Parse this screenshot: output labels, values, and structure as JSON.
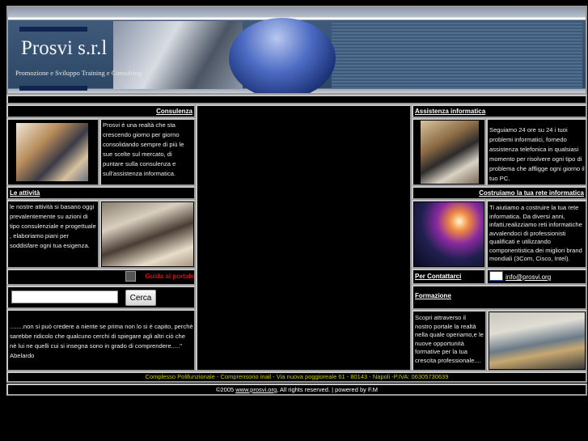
{
  "header": {
    "title": "Prosvi s.r.l",
    "subtitle": "Promozione e Sviluppo Training e Consulting"
  },
  "left": {
    "consulenza": {
      "label": "Consulenza",
      "text": "Prosvi è una realtà che sta crescendo giorno per giorno consolidando sempre di più le sue scelte sul mercato, di puntare sulla consulenza e sull'assistenza informatica."
    },
    "attivita": {
      "label": "Le attività",
      "text": "le nostre attività si basano oggi prevalentemente su azioni di tipo consulenziale e progettuale , elaboriamo piani per soddisfare ogni tua esigenza."
    },
    "guide": {
      "label": "Guida al portale"
    },
    "search": {
      "value": "",
      "button": "Cerca"
    },
    "quote": {
      "text": "........non si può credere a niente se prima non lo si è capito, perchè sarebbe ridicolo che qualcuno cerchi di spiegare agli altri ciò che nè lui ne quelli cui si insegna sono in grado di comprendere.....\"",
      "author": "Abelardo"
    }
  },
  "right": {
    "assistenza": {
      "label": "Assistenza informatica",
      "text": "Seguiamo 24 ore su 24 i tuoi problemi informatici, fornedo assistenza telefonica in qualsiasi momento per risolvere ogni tipo di problema che affligge ogni giorno il tuo PC."
    },
    "rete": {
      "label": "Costruiamo la tua rete informatica",
      "text": "Ti aiutiamo a costruire la tua rete informatica. Da diversi anni, infatti,realizziamo reti informatiche avvalendoci di professionisti qualificati e utilizzando componentistica dei migliori brand mondiali (3Com, Cisco, Intel)."
    },
    "contatti": {
      "label": "Per Contattarci",
      "email": "info@prosvi.org"
    },
    "formazione": {
      "label": "Formazione",
      "text": "Scopri attraverso il nostro portale la realtà nella quale operiamo,e le nuove opportunità formative per la tua crescita professionale...."
    }
  },
  "footer": {
    "address": "Complesso Polifunzionale - Comprensorio inail - Via nuova poggioreale 61 - 80143 - Napoli -P.IVA: 06305730639",
    "copy_prefix": "©2005",
    "site": "www.prosvi.org",
    "copy_suffix": ", All rights reserved. | powered by F.M"
  },
  "colors": {
    "guide": "#cc1111",
    "address": "#c8c800"
  }
}
